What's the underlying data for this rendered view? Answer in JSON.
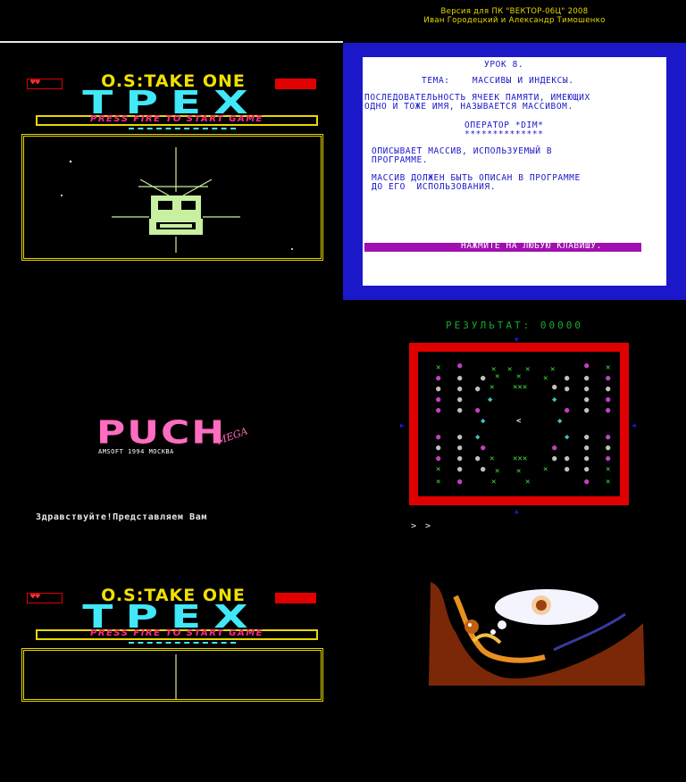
{
  "header": {
    "line1": "Версия для ПК \"ВЕКТОР-06Ц\" 2008",
    "line2": "Иван Городецкий и Александр Тимошенко"
  },
  "title_screen": {
    "os_title": "O.S:TAKE ONE",
    "big_title": "TPEX",
    "press": "PRESS FIRE TO START GAME",
    "heart": "♥♥"
  },
  "lesson": {
    "lines": [
      "УРОК 8.",
      "ТЕМА:    МАССИВЫ И ИНДЕКСЫ.",
      "ПОСЛЕДОВАТЕЛЬНОСТЬ ЯЧЕЕК ПАМЯТИ, ИМЕЮЩИХ",
      "ОДНО И ТОЖЕ ИМЯ, НАЗЫВАЕТСЯ МАССИВОМ.",
      "ОПЕРАТОР *DIM*",
      "**************",
      "ОПИСЫВАЕТ МАССИВ, ИСПОЛЬЗУЕМЫЙ В",
      "ПРОГРАММЕ.",
      "МАССИВ ДОЛЖЕН БЫТЬ ОПИСАН В ПРОГРАММЕ",
      "ДО ЕГО  ИСПОЛЬЗОВАНИЯ."
    ],
    "prompt": "НАЖМИТЕ НА ЛЮБУЮ КЛАВИШУ."
  },
  "logo": {
    "main": "PUCH",
    "sub": "AMSOFT 1994 МОСКВА",
    "script": "MEGA"
  },
  "greeting": "Здравствуйте!Представляем Вам",
  "game": {
    "score_label": "РЕЗУЛЬТАТ: 00000",
    "arrows": "> >"
  },
  "colors": {
    "yellow": "#e8d800",
    "cyan": "#40e8f8",
    "red": "#e00000",
    "blue": "#1a18c8",
    "magenta": "#ff6cc0",
    "green": "#18a830"
  }
}
